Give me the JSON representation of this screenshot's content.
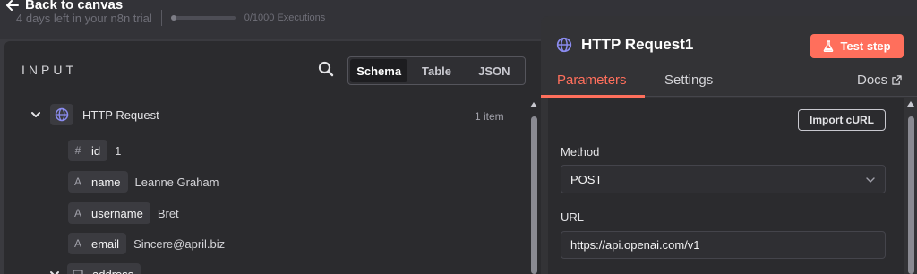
{
  "topbar": {
    "back_label": "Back to canvas",
    "trial_text": "4 days left in your n8n trial",
    "executions_text": "0/1000 Executions",
    "executions_progress": 0
  },
  "input": {
    "title": "INPUT",
    "view_options": [
      "Schema",
      "Table",
      "JSON"
    ],
    "active_view": "Schema",
    "node_name": "HTTP Request",
    "item_count": "1 item",
    "fields": [
      {
        "type": "#",
        "key": "id",
        "value": "1"
      },
      {
        "type": "A",
        "key": "name",
        "value": "Leanne Graham"
      },
      {
        "type": "A",
        "key": "username",
        "value": "Bret"
      },
      {
        "type": "A",
        "key": "email",
        "value": "Sincere@april.biz"
      }
    ],
    "partial_field": "address"
  },
  "node": {
    "title": "HTTP Request1",
    "test_button": "Test step",
    "tabs": [
      "Parameters",
      "Settings"
    ],
    "active_tab": "Parameters",
    "docs_label": "Docs",
    "import_curl": "Import cURL",
    "method_label": "Method",
    "method_value": "POST",
    "url_label": "URL",
    "url_value": "https://api.openai.com/v1"
  },
  "colors": {
    "accent": "#ff6f5c",
    "globe": "#8b8cf0"
  },
  "icons": {
    "back": "arrow-left-icon",
    "search": "search-icon",
    "node": "globe-icon",
    "test": "flask-icon",
    "docs": "external-link-icon"
  }
}
